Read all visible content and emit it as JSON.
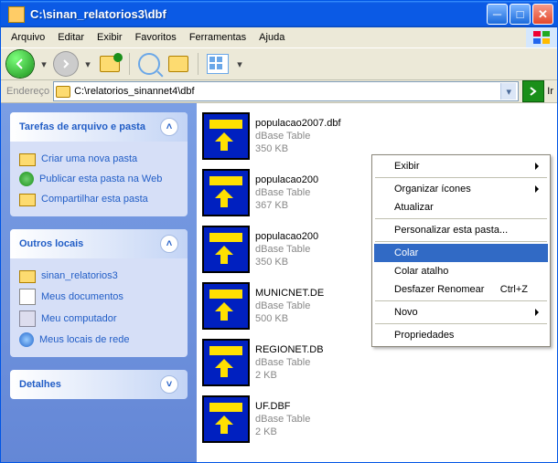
{
  "window": {
    "title": "C:\\sinan_relatorios3\\dbf"
  },
  "menubar": [
    "Arquivo",
    "Editar",
    "Exibir",
    "Favoritos",
    "Ferramentas",
    "Ajuda"
  ],
  "addressbar": {
    "label": "Endereço",
    "path": "C:\\relatorios_sinannet4\\dbf",
    "go": "Ir"
  },
  "sidebar": {
    "tasks": {
      "title": "Tarefas de arquivo e pasta",
      "items": [
        "Criar uma nova pasta",
        "Publicar esta pasta na Web",
        "Compartilhar esta pasta"
      ]
    },
    "places": {
      "title": "Outros locais",
      "items": [
        "sinan_relatorios3",
        "Meus documentos",
        "Meu computador",
        "Meus locais de rede"
      ]
    },
    "details": {
      "title": "Detalhes"
    }
  },
  "files": [
    {
      "name": "populacao2007.dbf",
      "type": "dBase Table",
      "size": "350 KB"
    },
    {
      "name": "populacao200",
      "type": "dBase Table",
      "size": "367 KB"
    },
    {
      "name": "populacao200",
      "type": "dBase Table",
      "size": "350 KB"
    },
    {
      "name": "MUNICNET.DE",
      "type": "dBase Table",
      "size": "500 KB"
    },
    {
      "name": "REGIONET.DB",
      "type": "dBase Table",
      "size": "2 KB"
    },
    {
      "name": "UF.DBF",
      "type": "dBase Table",
      "size": "2 KB"
    }
  ],
  "context_menu": {
    "items": [
      {
        "label": "Exibir",
        "submenu": true
      },
      {
        "sep": true
      },
      {
        "label": "Organizar ícones",
        "submenu": true
      },
      {
        "label": "Atualizar"
      },
      {
        "sep": true
      },
      {
        "label": "Personalizar esta pasta..."
      },
      {
        "sep": true
      },
      {
        "label": "Colar",
        "highlight": true
      },
      {
        "label": "Colar atalho"
      },
      {
        "label": "Desfazer Renomear",
        "shortcut": "Ctrl+Z"
      },
      {
        "sep": true
      },
      {
        "label": "Novo",
        "submenu": true
      },
      {
        "sep": true
      },
      {
        "label": "Propriedades"
      }
    ]
  }
}
